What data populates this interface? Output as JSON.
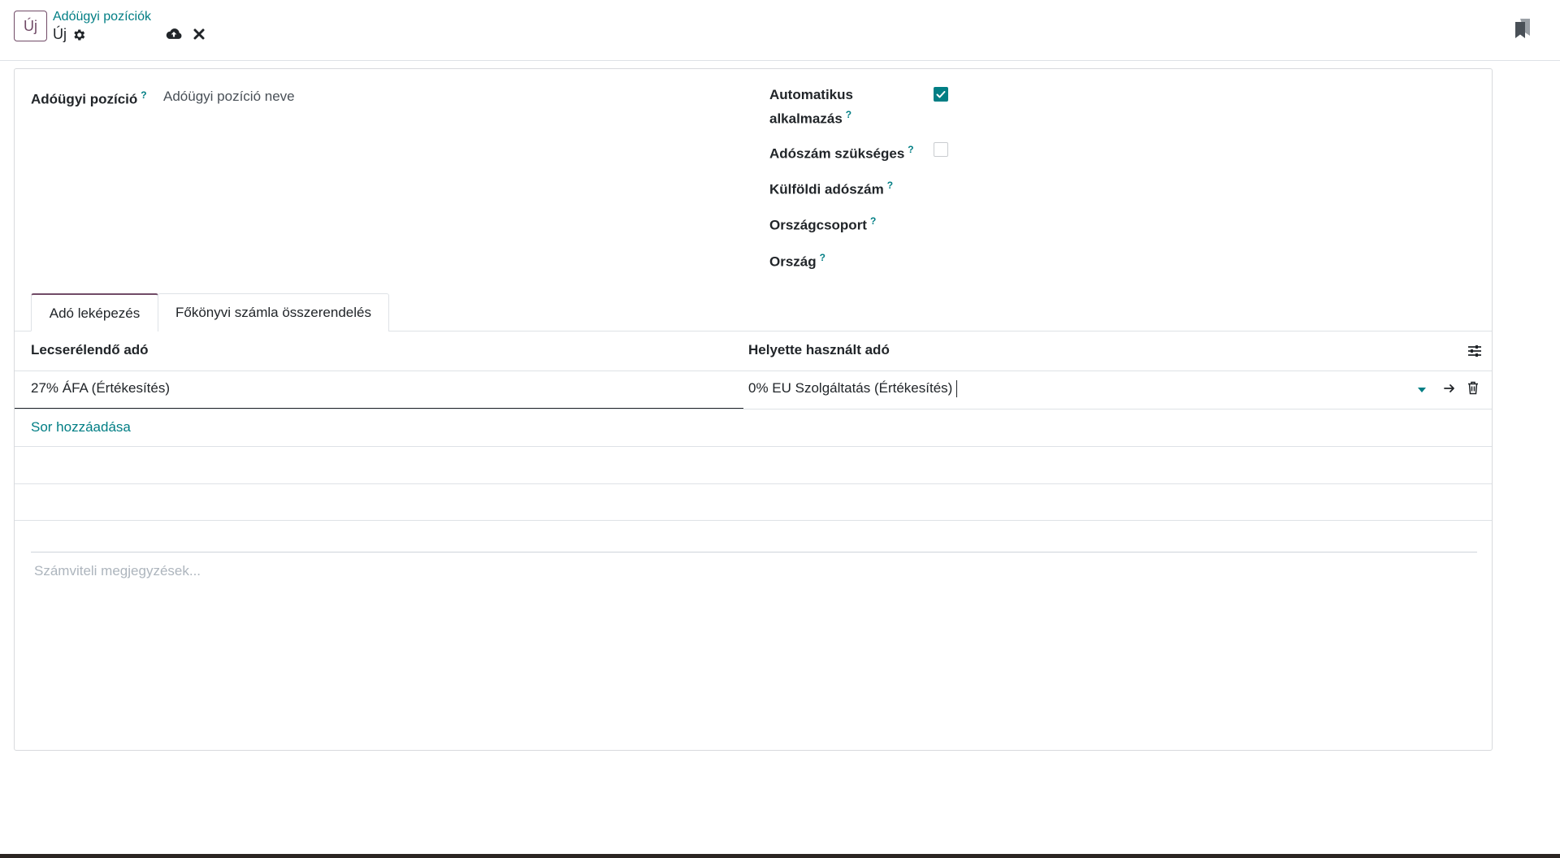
{
  "header": {
    "new_button": "Új",
    "breadcrumb_parent": "Adóügyi pozíciók",
    "breadcrumb_current": "Új"
  },
  "form": {
    "name_label": "Adóügyi pozíció",
    "name_placeholder": "Adóügyi pozíció neve",
    "help": "?",
    "auto_apply_label_line1": "Automatikus",
    "auto_apply_label_line2": "alkalmazás",
    "auto_apply_checked": true,
    "vat_required_label": "Adószám szükséges",
    "vat_required_checked": false,
    "foreign_vat_label": "Külföldi adószám",
    "country_group_label": "Országcsoport",
    "country_label": "Ország"
  },
  "tabs": [
    {
      "label": "Adó leképezés",
      "active": true
    },
    {
      "label": "Főkönyvi számla összerendelés",
      "active": false
    }
  ],
  "tax_list": {
    "col_source": "Lecserélendő adó",
    "col_dest": "Helyette használt adó",
    "rows": [
      {
        "source": "27% ÁFA (Értékesítés)",
        "dest": "0% EU Szolgáltatás (Értékesítés)"
      }
    ],
    "add_line": "Sor hozzáadása"
  },
  "notes": {
    "placeholder": "Számviteli megjegyzések..."
  },
  "colors": {
    "accent": "#017e84",
    "brand": "#714B67"
  }
}
